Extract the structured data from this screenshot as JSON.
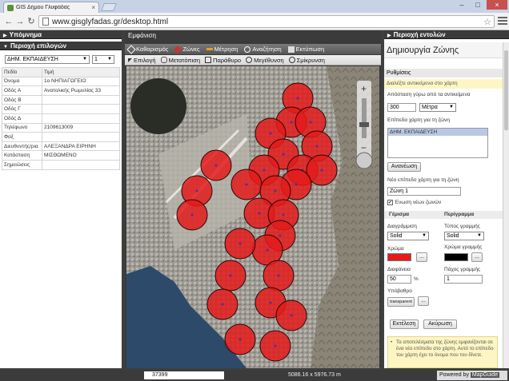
{
  "browser": {
    "tab_title": "GIS Δήμου Γλυφάδας",
    "url": "www.gisglyfadas.gr/desktop.html"
  },
  "left": {
    "legend_header": "Υπόμνημα",
    "selection_header": "Περιοχή επιλογών",
    "layer_select": "ΔΗΜ. ΕΚΠΑΙΔΕΥΣΗ",
    "count_select": "1",
    "col_field": "Πεδίο",
    "col_value": "Τιμή",
    "rows": [
      {
        "k": "Όνομα",
        "v": "1ο ΝΗΠΙΑΓΩΓΕΙΟ"
      },
      {
        "k": "Οδός Α",
        "v": "Ανατολικής Ρωμυλίας 33"
      },
      {
        "k": "Οδός Β",
        "v": ""
      },
      {
        "k": "Οδός Γ",
        "v": ""
      },
      {
        "k": "Οδός Δ",
        "v": ""
      },
      {
        "k": "Τηλέφωνο",
        "v": "2109613009"
      },
      {
        "k": "Φαξ",
        "v": ""
      },
      {
        "k": "Διευθυντής/ρια",
        "v": "ΑΛΕΞΑΝΔΡΑ ΕΙΡΗΝΗ"
      },
      {
        "k": "Κατάσταση",
        "v": "ΜΙΣΘΩΜΕΝΟ"
      },
      {
        "k": "Σημειώσεις",
        "v": ""
      }
    ]
  },
  "map": {
    "title": "Εμφάνιση",
    "toolbar1": [
      "Καθαρισμός",
      "Ζώνες",
      "Μέτρηση",
      "Αναζήτηση",
      "Εκτύπωση"
    ],
    "toolbar2": [
      "Επιλογή",
      "Μετατόπιση",
      "Παράθυρο",
      "Μεγέθυνση",
      "Σμίκρυνση"
    ]
  },
  "right": {
    "header": "Περιοχή εντολών",
    "title": "Δημιουργία Ζώνης",
    "settings": "Ρυθμίσεις",
    "hint": "Διαλέξτε αντικείμενα στο χάρτη",
    "distance_label": "Απόσταση γύρω από τα αντικείμενα",
    "distance_value": "300",
    "unit": "Μέτρα",
    "layers_label": "Επίπεδα χάρτη για τη ζώνη",
    "layers_item": "ΔΗΜ. ΕΚΠΑΙΔΕΥΣΗ",
    "refresh": "Ανανέωση",
    "new_layer_label": "Νέο επίπεδο χάρτη για τη ζώνη",
    "new_layer_value": "Ζώνη 1",
    "merge_label": "Ένωση νέων ζωνών",
    "fill_header": "Γέμισμα",
    "outline_header": "Περίγραμμα",
    "pattern_label": "Διαγράμμιση",
    "pattern_value": "Solid",
    "line_type_label": "Τύπος γραμμής",
    "line_type_value": "Solid",
    "color_label": "Χρώμα",
    "line_color_label": "Χρώμα γραμμής",
    "fill_color": "#e31b1b",
    "line_color": "#000000",
    "transparency_label": "Διαφάνεια",
    "transparency_value": "50",
    "transparency_unit": "%",
    "thickness_label": "Πάχος γραμμής",
    "thickness_value": "1",
    "background_label": "Υπόβαθρο",
    "background_value": "transparent",
    "run": "Εκτέλεση",
    "cancel": "Ακύρωση",
    "info": "Τα αποτελέσματα της ζώνης εμφανίζονται σε ένα νέο επίπεδο στο χάρτη. Αυτό το επίπεδο του χάρτη έχει το όνομα που του δίνετε."
  },
  "status": {
    "scale": "37399",
    "coords": "5086.16 x 5976.73 m",
    "powered": "Powered by",
    "brand": "MapGuide"
  }
}
